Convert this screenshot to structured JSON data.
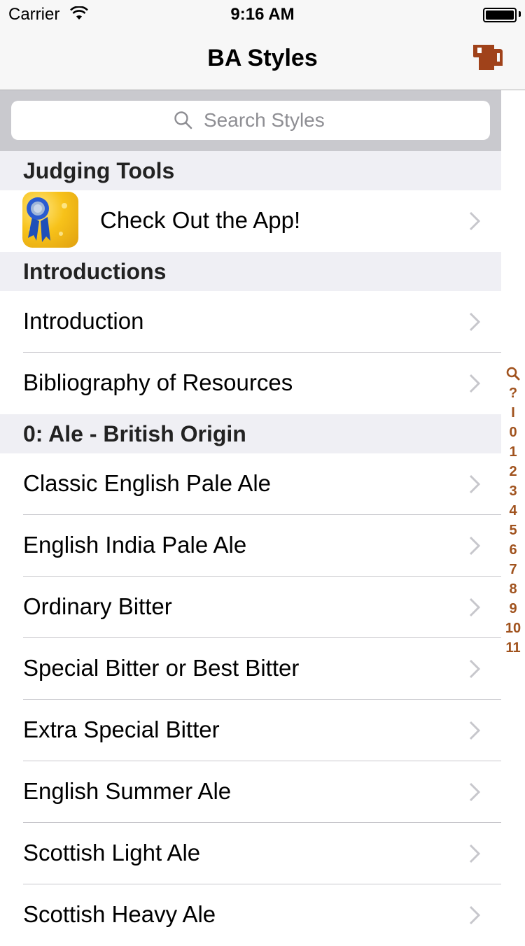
{
  "status_bar": {
    "carrier": "Carrier",
    "time": "9:16 AM",
    "wifi_icon": "wifi-icon",
    "battery_icon": "battery-icon"
  },
  "nav": {
    "title": "BA Styles",
    "right_icon": "beer-mug-icon"
  },
  "search": {
    "placeholder": "Search Styles",
    "icon": "search-icon"
  },
  "sections": [
    {
      "title": "Judging Tools",
      "rows": [
        {
          "label": "Check Out the App!",
          "icon": "app-icon"
        }
      ]
    },
    {
      "title": "Introductions",
      "rows": [
        {
          "label": "Introduction"
        },
        {
          "label": "Bibliography of Resources"
        }
      ]
    },
    {
      "title": "0: Ale - British Origin",
      "rows": [
        {
          "label": "Classic English Pale Ale"
        },
        {
          "label": "English India Pale Ale"
        },
        {
          "label": "Ordinary Bitter"
        },
        {
          "label": "Special Bitter or Best Bitter"
        },
        {
          "label": "Extra Special Bitter"
        },
        {
          "label": "English Summer Ale"
        },
        {
          "label": "Scottish Light Ale"
        },
        {
          "label": "Scottish Heavy Ale"
        }
      ]
    }
  ],
  "index": [
    "?",
    "I",
    "0",
    "1",
    "2",
    "3",
    "4",
    "5",
    "6",
    "7",
    "8",
    "9",
    "10",
    "11"
  ],
  "colors": {
    "accent": "#a0521d",
    "nav_background": "#f7f7f7",
    "section_header": "#efeff4",
    "search_background": "#c9c9ce"
  }
}
